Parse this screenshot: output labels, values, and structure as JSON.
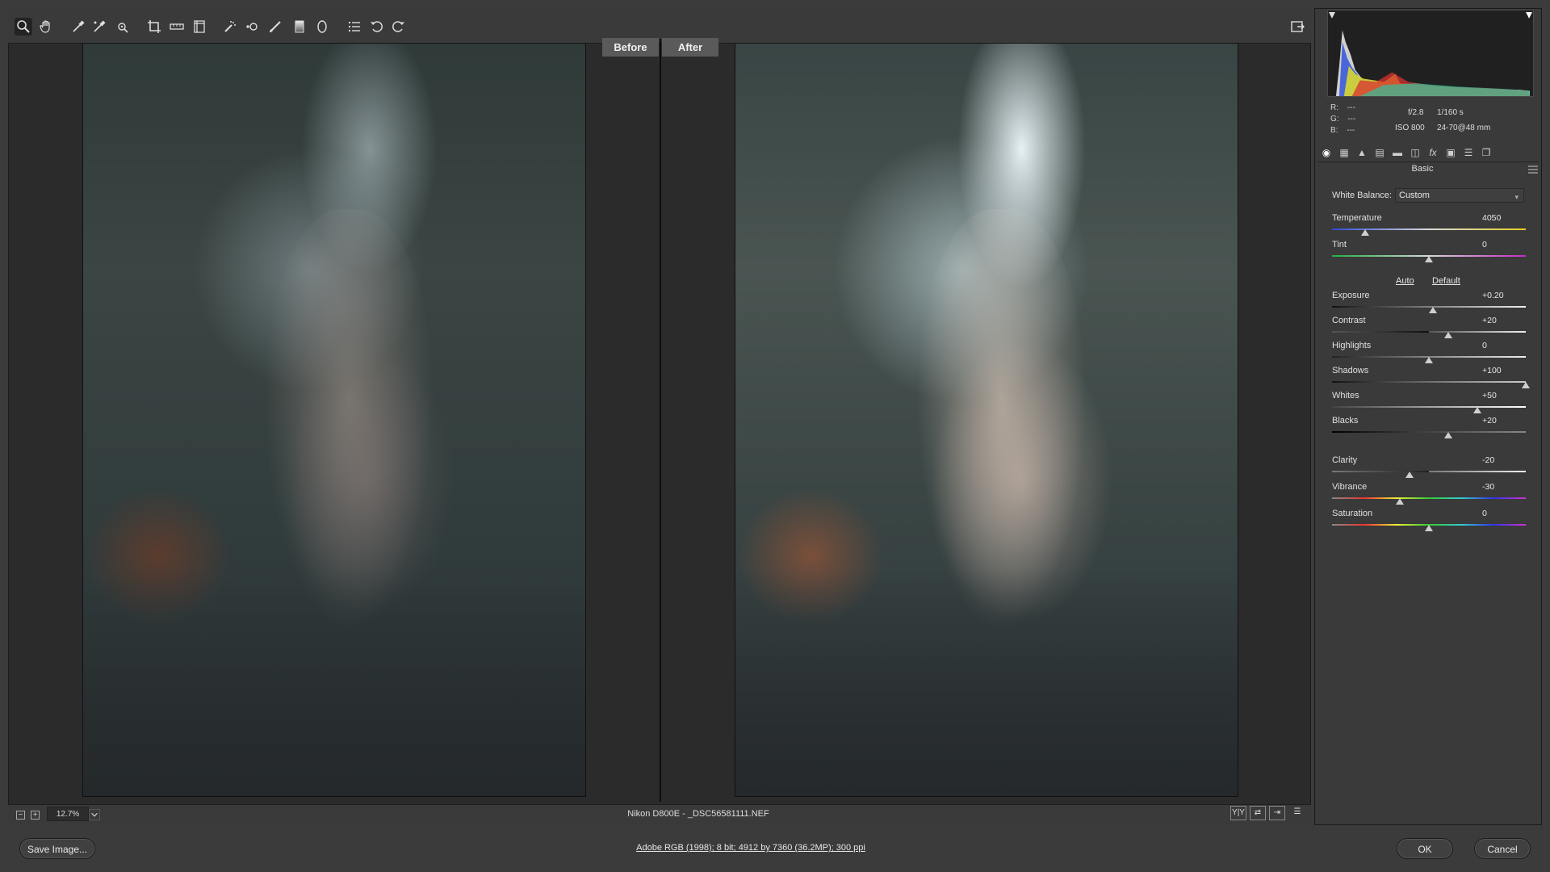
{
  "toolbar": {
    "tools": [
      {
        "name": "zoom-tool"
      },
      {
        "name": "hand-tool"
      },
      {
        "name": "white-balance-tool"
      },
      {
        "name": "color-sampler-tool"
      },
      {
        "name": "targeted-adjustment-tool"
      },
      {
        "name": "crop-tool"
      },
      {
        "name": "straighten-tool"
      },
      {
        "name": "transform-tool"
      },
      {
        "name": "spot-removal-tool"
      },
      {
        "name": "red-eye-tool"
      },
      {
        "name": "adjustment-brush-tool"
      },
      {
        "name": "graduated-filter-tool"
      },
      {
        "name": "radial-filter-tool"
      },
      {
        "name": "preferences-tool"
      },
      {
        "name": "rotate-left-tool"
      },
      {
        "name": "rotate-right-tool"
      }
    ]
  },
  "preview": {
    "before_label": "Before",
    "after_label": "After"
  },
  "status": {
    "zoom": "12.7%",
    "camera_file": "Nikon D800E  -  _DSC56581111.NEF"
  },
  "histogram": {
    "r_label": "R:",
    "g_label": "G:",
    "b_label": "B:",
    "r_value": "---",
    "g_value": "---",
    "b_value": "---",
    "aperture": "f/2.8",
    "shutter": "1/160 s",
    "iso": "ISO 800",
    "lens": "24-70@48 mm"
  },
  "panel": {
    "title": "Basic",
    "white_balance_label": "White Balance:",
    "white_balance_value": "Custom",
    "auto_link": "Auto",
    "default_link": "Default",
    "sliders": {
      "temperature": {
        "label": "Temperature",
        "value": "4050",
        "fraction": 0.17
      },
      "tint": {
        "label": "Tint",
        "value": "0",
        "fraction": 0.5
      },
      "exposure": {
        "label": "Exposure",
        "value": "+0.20",
        "fraction": 0.52
      },
      "contrast": {
        "label": "Contrast",
        "value": "+20",
        "fraction": 0.6
      },
      "highlights": {
        "label": "Highlights",
        "value": "0",
        "fraction": 0.5
      },
      "shadows": {
        "label": "Shadows",
        "value": "+100",
        "fraction": 1.0
      },
      "whites": {
        "label": "Whites",
        "value": "+50",
        "fraction": 0.75
      },
      "blacks": {
        "label": "Blacks",
        "value": "+20",
        "fraction": 0.6
      },
      "clarity": {
        "label": "Clarity",
        "value": "-20",
        "fraction": 0.4
      },
      "vibrance": {
        "label": "Vibrance",
        "value": "-30",
        "fraction": 0.35
      },
      "saturation": {
        "label": "Saturation",
        "value": "0",
        "fraction": 0.5
      }
    }
  },
  "bottom": {
    "save_label": "Save Image...",
    "workflow_info": "Adobe RGB (1998); 8 bit; 4912 by 7360 (36.2MP); 300 ppi",
    "ok_label": "OK",
    "cancel_label": "Cancel"
  }
}
